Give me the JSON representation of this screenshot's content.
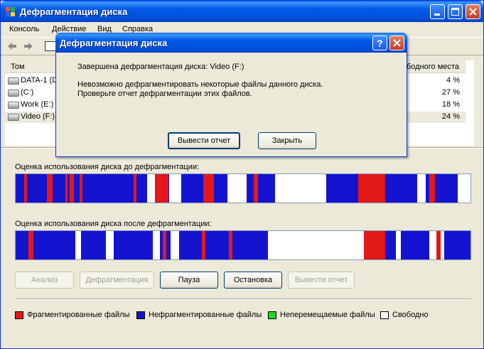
{
  "window": {
    "title": "Дефрагментация диска"
  },
  "menu": [
    "Консоль",
    "Действие",
    "Вид",
    "Справка"
  ],
  "list": {
    "col_volume": "Том",
    "col_free": "бодного места",
    "rows": [
      {
        "name": "DATA-1 (D",
        "free": "4 %"
      },
      {
        "name": "(C:)",
        "free": "27 %"
      },
      {
        "name": "Work (E:)",
        "free": "18 %"
      },
      {
        "name": "Video (F:)",
        "free": "24 %",
        "selected": true
      }
    ]
  },
  "before": {
    "label": "Оценка использования диска до дефрагментации:"
  },
  "after": {
    "label": "Оценка использования диска после дефрагментации:"
  },
  "buttons": {
    "analyze": "Анализ",
    "defrag": "Дефрагментация",
    "pause": "Пауза",
    "stop": "Остановка",
    "report": "Вывести отчет"
  },
  "legend": [
    {
      "label": "Фрагментированные файлы",
      "color": "#e31818"
    },
    {
      "label": "Нефрагментированные файлы",
      "color": "#1414d0"
    },
    {
      "label": "Неперемещаемые файлы",
      "color": "#1cdc1c"
    },
    {
      "label": "Свободно",
      "color": "#ffffff"
    }
  ],
  "dialog": {
    "title": "Дефрагментация диска",
    "line1": "Завершена дефрагментация диска: Video (F:)",
    "line2": "Невозможно дефрагментировать некоторые файлы данного диска.",
    "line3": "Проверьте отчет дефрагментации этих файлов.",
    "report_button": "Вывести отчет",
    "close_button": "Закрыть"
  },
  "colors": {
    "fragmented": "#e31818",
    "contiguous": "#1414d0",
    "free": "#ffffff",
    "title_blue": "#0058e6"
  }
}
